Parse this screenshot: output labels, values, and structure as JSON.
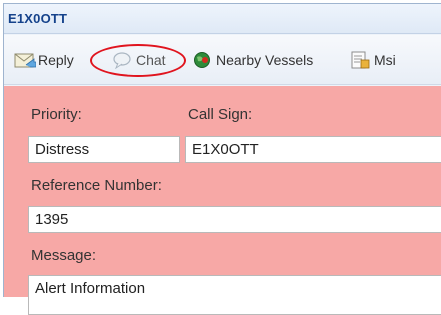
{
  "window": {
    "title": "E1X0OTT"
  },
  "toolbar": {
    "reply_label": "Reply",
    "chat_label": "Chat",
    "nearby_label": "Nearby Vessels",
    "msi_label": "Msi"
  },
  "form": {
    "priority": {
      "label": "Priority:",
      "value": "Distress"
    },
    "call_sign": {
      "label": "Call Sign:",
      "value": "E1X0OTT"
    },
    "reference_number": {
      "label": "Reference Number:",
      "value": "1395"
    },
    "message": {
      "label": "Message:",
      "value": "Alert Information"
    }
  },
  "colors": {
    "form_background": "#f7a8a6",
    "title_text": "#15428b",
    "highlight_ring": "#e0141e"
  },
  "icons": {
    "reply": "envelope-reply-icon",
    "chat": "chat-bubble-icon",
    "nearby": "globe-icon",
    "msi": "document-icon"
  }
}
